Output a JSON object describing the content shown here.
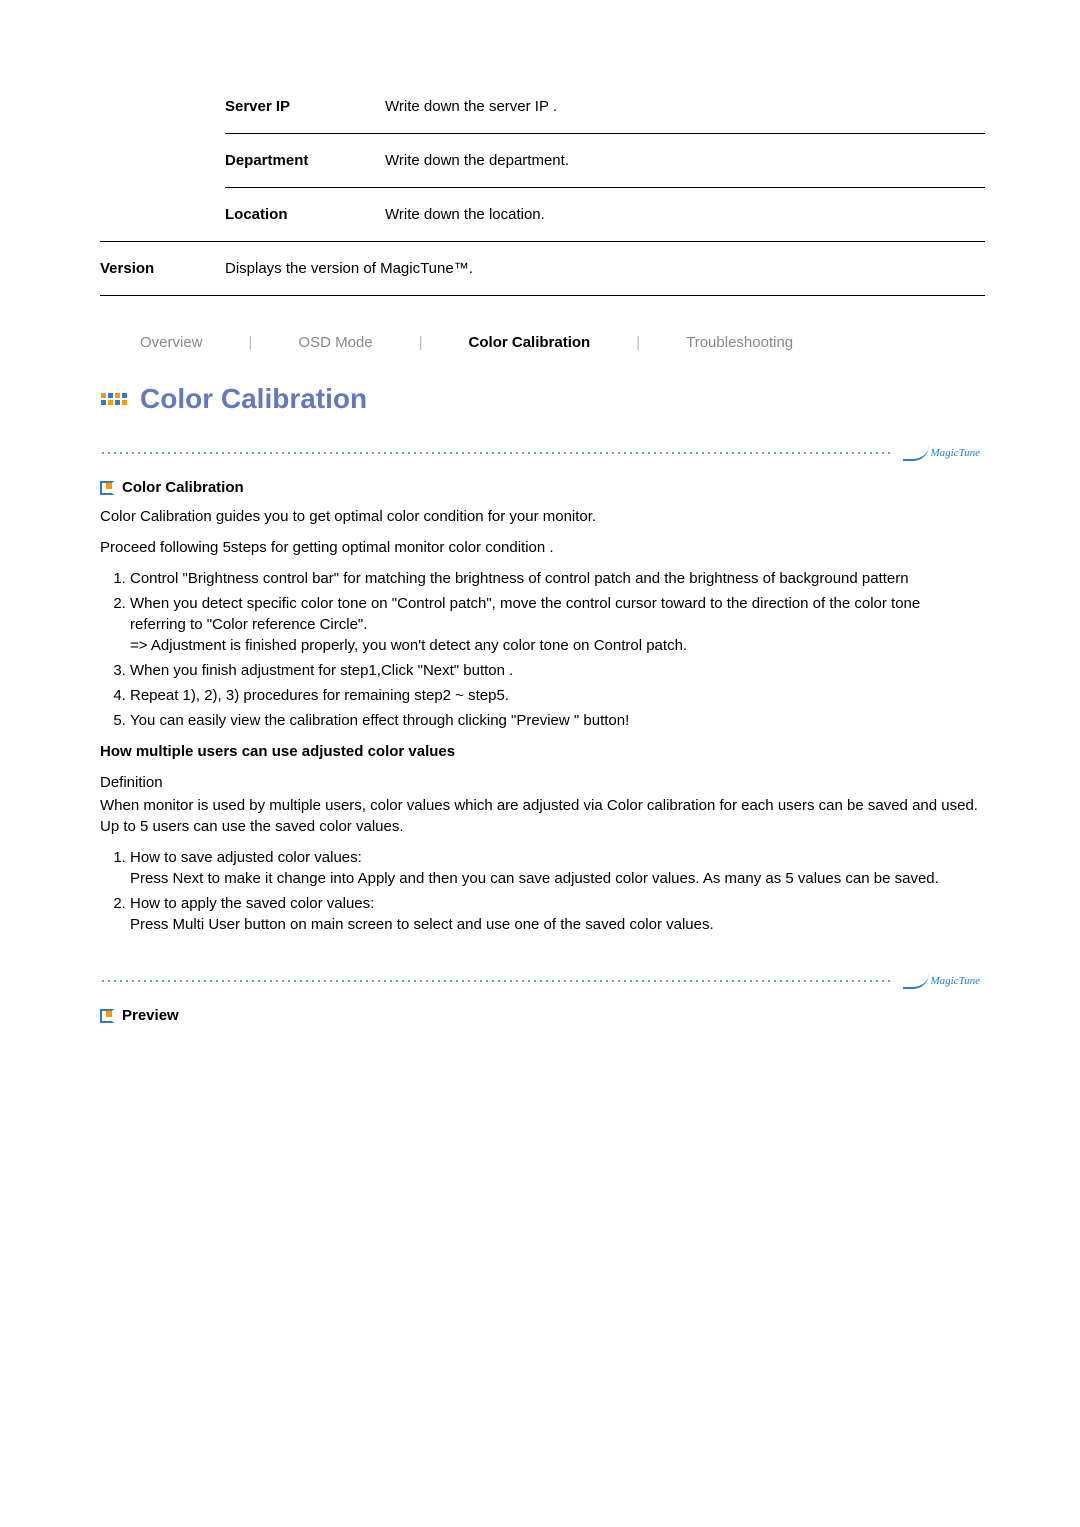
{
  "info_rows": [
    {
      "label": "Server IP",
      "value": "Write down the server IP ."
    },
    {
      "label": "Department",
      "value": "Write down the department."
    },
    {
      "label": "Location",
      "value": "Write down the location."
    }
  ],
  "version": {
    "label": "Version",
    "value": "Displays the version of MagicTune™."
  },
  "tabs": {
    "overview": "Overview",
    "osd_mode": "OSD Mode",
    "color_calibration": "Color Calibration",
    "troubleshooting": "Troubleshooting"
  },
  "heading": "Color Calibration",
  "logo_text": "MagicTune",
  "section1": {
    "title": "Color Calibration",
    "intro1": "Color Calibration guides you to get optimal color condition for your monitor.",
    "intro2": "Proceed following 5steps for getting optimal monitor color condition .",
    "steps": [
      "Control \"Brightness control bar\" for matching the brightness of control patch and the brightness of background pattern",
      "When you detect specific color tone on \"Control patch\", move the control cursor toward to the direction of the color tone referring to \"Color reference Circle\".\n=> Adjustment is finished properly, you won't detect any color tone on Control patch.",
      "When you finish adjustment for step1,Click \"Next\" button .",
      "Repeat 1), 2), 3) procedures for remaining step2 ~ step5.",
      "You can easily view the calibration effect through clicking \"Preview \" button!"
    ],
    "multi_title": "How multiple users can use adjusted color values",
    "definition_label": "Definition",
    "definition": "When monitor is used by multiple users, color values which are adjusted via Color calibration for each users can be saved and used. Up to 5 users can use the saved color values.",
    "multi_steps": [
      "How to save adjusted color values:\nPress Next to make it change into Apply and then you can save adjusted color values. As many as 5 values can be saved.",
      "How to apply the saved color values:\nPress Multi User button on main screen to select and use one of the saved color values."
    ]
  },
  "section2": {
    "title": "Preview"
  }
}
